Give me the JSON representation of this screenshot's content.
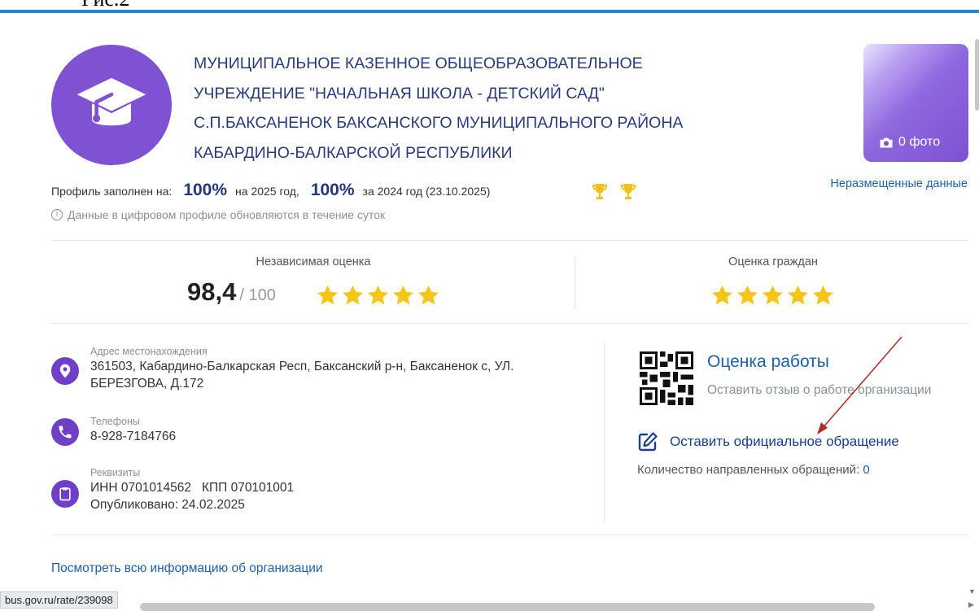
{
  "doc_caption": "Рис.2",
  "org": {
    "title_lines": [
      "МУНИЦИПАЛЬНОЕ КАЗЕННОЕ ОБЩЕОБРАЗОВАТЕЛЬНОЕ",
      "УЧРЕЖДЕНИЕ \"НАЧАЛЬНАЯ ШКОЛА - ДЕТСКИЙ САД\"",
      "С.П.БАКСАНЕНОК БАКСАНСКОГО МУНИЦИПАЛЬНОГО РАЙОНА",
      "КАБАРДИНО-БАЛКАРСКОЙ РЕСПУБЛИКИ"
    ],
    "logo_icon": "graduation-cap-icon",
    "photo_label": "0 фото"
  },
  "profile": {
    "filled_label": "Профиль заполнен на:",
    "pct_current": "100%",
    "current_year_label": "на 2025 год,",
    "pct_prev": "100%",
    "prev_year_label": "за 2024 год (23.10.2025)",
    "unplaced_link": "Неразмещенные данные",
    "update_note": "Данные в цифровом профиле обновляются в течение суток"
  },
  "ratings": {
    "independent_label": "Независимая оценка",
    "independent_score": "98,4",
    "independent_max": "/ 100",
    "independent_stars": 5,
    "citizens_label": "Оценка граждан",
    "citizens_stars": 5,
    "star_color": "#f5c518"
  },
  "contacts": {
    "address_caption": "Адрес местонахождения",
    "address_line1": "361503, Кабардино-Балкарская Респ, Баксанский р-н, Баксаненок с, УЛ.",
    "address_line2": "БЕРЕЗГОВА, Д.172",
    "phones_caption": "Телефоны",
    "phone": "8-928-7184766",
    "requisites_caption": "Реквизиты",
    "requisites_line": "ИНН 0701014562   КПП 070101001",
    "published": "Опубликовано: 24.02.2025"
  },
  "feedback": {
    "eval_title": "Оценка работы",
    "eval_sub": "Оставить отзыв о работе организации",
    "appeal_link": "Оставить официальное обращение",
    "appeal_count_label": "Количество направленных обращений:",
    "appeal_count": "0"
  },
  "all_info_link": "Посмотреть всю информацию об организации",
  "status_url": "bus.gov.ru/rate/239098",
  "colors": {
    "accent": "#2a86c6",
    "purple": "#7e52d3",
    "link": "#1f5fa8",
    "annotation_arrow": "#b0302c"
  }
}
